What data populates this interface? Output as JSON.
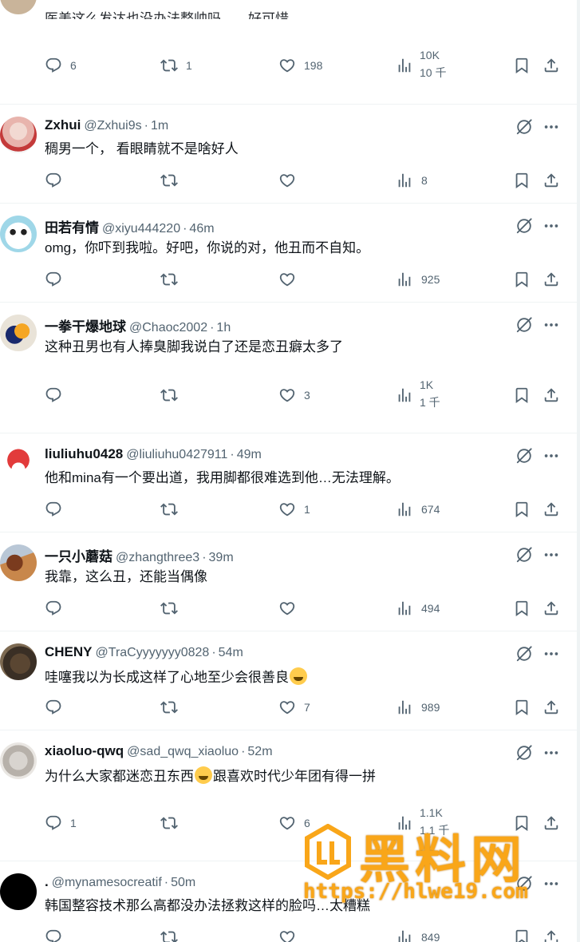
{
  "top_post": {
    "text": "医美这么发达也没办法整帅吗……好可惜……",
    "reply_count": "6",
    "retweet_count": "1",
    "like_count": "198",
    "views_line1": "10K",
    "views_line2": "10 千"
  },
  "posts": [
    {
      "name": "Zxhui",
      "handle": "@Zxhui9s",
      "time": "1m",
      "text": "稠男一个，  看眼睛就不是啥好人",
      "reply": "",
      "retweet": "",
      "like": "",
      "views": "8"
    },
    {
      "name": "田若有情",
      "handle": "@xiyu444220",
      "time": "46m",
      "text": "omg，你吓到我啦。好吧，你说的对，他丑而不自知。",
      "reply": "",
      "retweet": "",
      "like": "",
      "views": "925"
    },
    {
      "name": "一拳干爆地球",
      "handle": "@Chaoc2002",
      "time": "1h",
      "text": "这种丑男也有人捧臭脚我说白了还是恋丑癖太多了",
      "reply": "",
      "retweet": "",
      "like": "3",
      "views_line1": "1K",
      "views_line2": "1 千"
    },
    {
      "name": "liuliuhu0428",
      "handle": "@liuliuhu0427911",
      "time": "49m",
      "text": "他和mina有一个要出道，我用脚都很难选到他…无法理解。",
      "reply": "",
      "retweet": "",
      "like": "1",
      "views": "674"
    },
    {
      "name": "一只小蘑菇",
      "handle": "@zhangthree3",
      "time": "39m",
      "text": "我靠，这么丑，还能当偶像",
      "reply": "",
      "retweet": "",
      "like": "",
      "views": "494"
    },
    {
      "name": "CHENY",
      "handle": "@TraCyyyyyyy0828",
      "time": "54m",
      "text_before": "哇噻我以为长成这样了心地至少会很善良",
      "text_after": "",
      "reply": "",
      "retweet": "",
      "like": "7",
      "views": "989"
    },
    {
      "name": "xiaoluo-qwq",
      "handle": "@sad_qwq_xiaoluo",
      "time": "52m",
      "text_before": "为什么大家都迷恋丑东西",
      "text_after": "跟喜欢时代少年团有得一拼",
      "reply": "1",
      "retweet": "",
      "like": "6",
      "views_line1": "1.1K",
      "views_line2": "1.1 千"
    },
    {
      "name": ".",
      "handle": "@mynamesocreatif",
      "time": "50m",
      "text": "韩国整容技术那么高都没办法拯救这样的脸吗…太糟糕",
      "reply": "",
      "retweet": "",
      "like": "",
      "views": "849"
    }
  ],
  "watermark": {
    "title": "黑料网",
    "url": "https://hlwe19.com"
  },
  "colors": {
    "text_primary": "#0f1419",
    "text_secondary": "#536471",
    "divider": "#eff3f4",
    "watermark": "#f9a619"
  },
  "icons": [
    "reply-icon",
    "retweet-icon",
    "like-icon",
    "views-icon",
    "bookmark-icon",
    "share-icon",
    "grok-icon",
    "more-icon"
  ]
}
